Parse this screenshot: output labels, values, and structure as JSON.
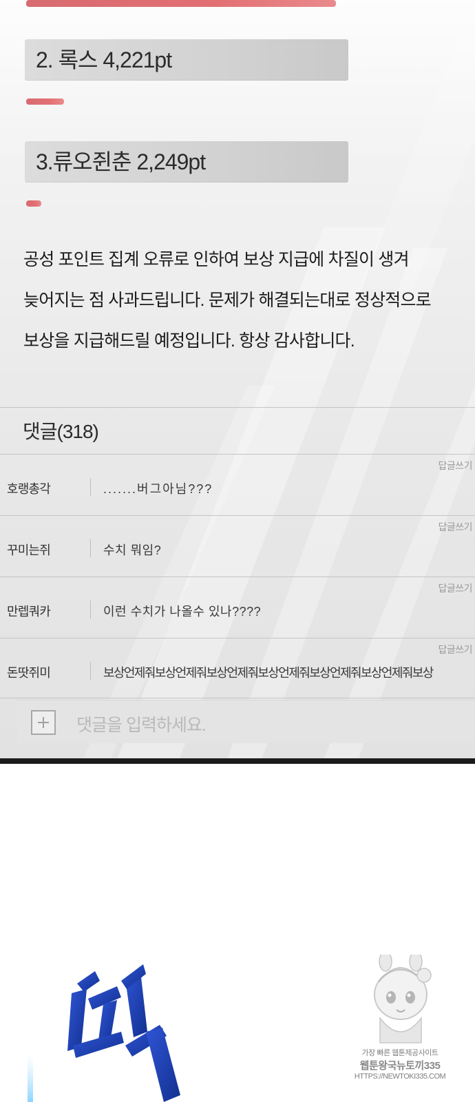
{
  "rankings": [
    {
      "label": "2. 록스 4,221pt",
      "bar_fill": 1.0
    },
    {
      "label": "3.류오쥔춘 2,249pt",
      "bar_fill": 0.12
    }
  ],
  "top_bar_fill": 1.0,
  "notice": {
    "lines": [
      "공성 포인트 집계 오류로 인하여 보상 지급에 차질이 생겨",
      "늦어지는 점 사과드립니다. 문제가 해결되는대로 정상적으로",
      "보상을 지급해드릴 예정입니다. 항상 감사합니다."
    ]
  },
  "comments": {
    "title": "댓글(318)",
    "reply_label": "답글쓰기",
    "items": [
      {
        "author": "호랭총각",
        "text": ".......버그아님???"
      },
      {
        "author": "꾸미는쥐",
        "text": "수치 뭐임?"
      },
      {
        "author": "만렙쿼카",
        "text": "이런 수치가 나올수 있나????"
      },
      {
        "author": "돈땃쥐미",
        "text": "보상언제줘보상언제줘보상언제줘보상언제줘보상언제줘보상언제줘보상"
      }
    ],
    "input_placeholder": "댓글을 입력하세요."
  },
  "watermark": {
    "line1": "가장 빠른 웹툰제공사이트",
    "line2": "웹툰왕국뉴토끼335",
    "line3": "HTTPS://NEWTOKI335.COM"
  },
  "colors": {
    "bar_red": "#e26f72",
    "sfx_blue": "#1f3fb8",
    "panel_grey": "#e6e6e6"
  }
}
